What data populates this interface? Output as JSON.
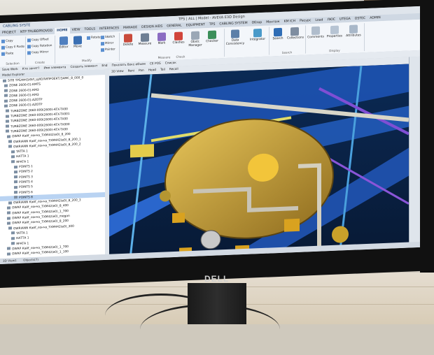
{
  "window": {
    "title": "TPS | ALL | Model - AVEVA E3D Design"
  },
  "quick_access": "CABLING SYSTE",
  "ribbon_tabs": [
    "PROJECT",
    "NTP TRUBOPROVOD",
    "HOME",
    "VIEW",
    "TOOLS",
    "INTERFACES",
    "MANAGE",
    "DESIGN AIDS",
    "GENERAL",
    "EQUIPMENT",
    "TPS",
    "CABLING SYSTEM",
    "Обзор",
    "Монтаж",
    "KM ICH",
    "Ресурс",
    "Load",
    "ЛЮС",
    "UTEGA",
    "OSTEC",
    "ADMIN"
  ],
  "active_tab": "HOME",
  "ribbon": {
    "selection_group": {
      "label": "Selection",
      "items": [
        "Copy",
        "Copy Il Paste",
        "Paste"
      ]
    },
    "create_group": {
      "label": "Create",
      "items": [
        "Copy Offset",
        "Copy Rotation",
        "Copy Mirror"
      ]
    },
    "modify_group": {
      "label": "Modify",
      "buttons": [
        "Editor",
        "Move",
        "Rotate",
        "Sketch",
        "Mirror",
        "Painter"
      ]
    },
    "delete_group": {
      "buttons": [
        "Delete",
        "Measure",
        "Mark",
        "Clashes",
        "Obstr. Manager",
        "Checker"
      ]
    },
    "measure_label": "Measure",
    "check_label": "Check",
    "consistency_group": {
      "buttons": [
        "Data Consistency",
        "Integrator"
      ]
    },
    "search_group": {
      "label": "Search",
      "buttons": [
        "Search",
        "Collections"
      ]
    },
    "display_group": {
      "label": "Display",
      "buttons": [
        "Comments",
        "Properties",
        "Attributes"
      ]
    }
  },
  "toolbar2": [
    "Save Work",
    "Кто занят?",
    "Имя элемента",
    "Создать элемент",
    "End",
    "Показать бокс-объем",
    "CE POS",
    "Список"
  ],
  "tree": {
    "header": "Model Explorer",
    "rows": [
      "SITE TPS/ФНЗ/ФЛ_ЦИОЛИПРОЕКТ/ЗАМС_8_000_0",
      "ZONE 2600-01-KMTS",
      "ZONE 2600-01-КМЗ",
      "ZONE 2600-01-КМЗ",
      "ZONE 2600-01-AZOTP",
      "ZONE 2600-01-AZOTP",
      "TURBZONE 2660-009(2600)-ATX-TX00",
      "TURBZONE 2660-009(2600)-ATX-TX001",
      "TURBZONE 2660-009(2600)-ATX-TX00",
      "TURBZONE 2660-009(2600)-ATX-TX000",
      "TURBZONE 2660-009(2600)-ATX-TX00",
      "OWRP Кайf_лонча_TXM442(e0)_8_200",
      "OWRIANN Кайf_лонча_TXM442(e0)_8_200_1",
      "OWRIANN Кайf_лонча_TXM442(e0)_8_200_2",
      "TATTA 1",
      "НАТТА 1",
      "ЯРАТА 1",
      "POINTS 1",
      "POINTS 2",
      "POINTS 3",
      "POINTS 4",
      "POINTS 5",
      "POINTS 6",
      "POINTS 8",
      "OWRIANN Кайf_лонча_TXM442(e0)_8_200_3",
      "OWRP Кайf_лонча_TXM42(e0)_8_400",
      "OWRP Кайf_лонча_TXM42(e0)_1_700",
      "OWRP Кайf_лонча_TXM42(e0)_megan",
      "OWRP Кайf_лонча_TXM42(e0)_8_200",
      "OWRIANN Кайf_лонча_TXM442(e0)_300",
      "TATTA 1",
      "НАТТА 1",
      "ЯРАТА 1",
      "OWRP Кайf_лонча_TXM42(e0)_1_700",
      "OWRP Кайf_лонча_TXM42(e0)_1_100"
    ],
    "selected_index": 23
  },
  "viewport_toolbar": [
    "3D View",
    "Reni",
    "Pan",
    "Head",
    "Tail",
    "Recall"
  ],
  "statusbar": [
    "3D View1",
    "Objects(7)"
  ],
  "monitor_brand": "DELL"
}
